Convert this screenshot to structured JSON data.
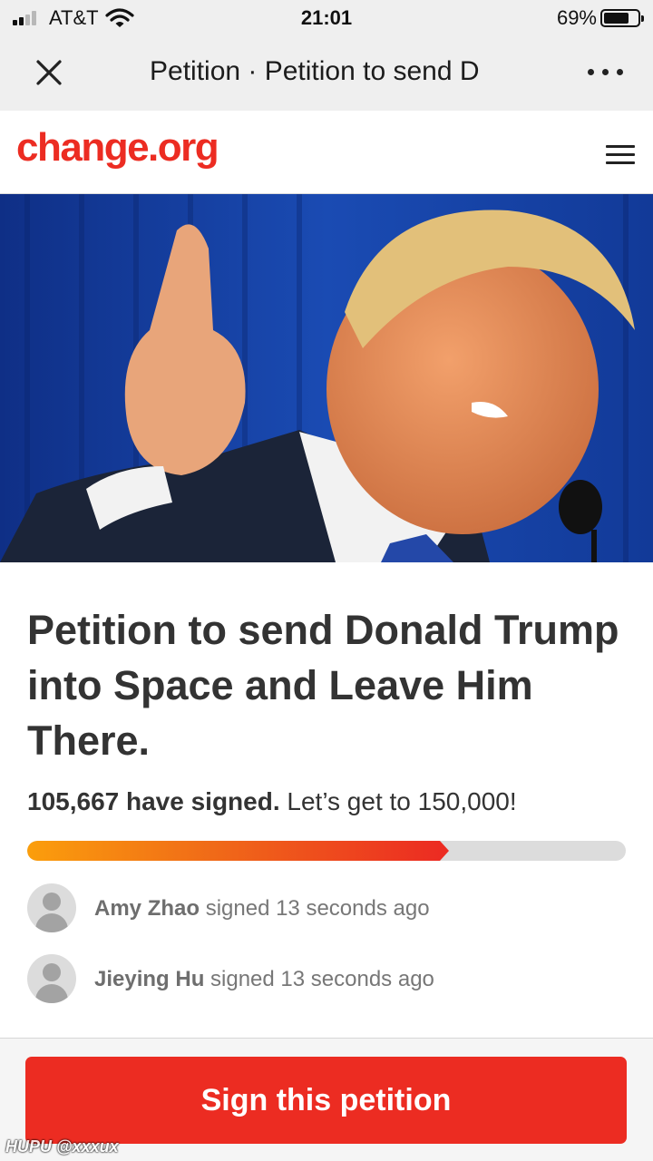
{
  "status_bar": {
    "carrier": "AT&T",
    "time": "21:01",
    "battery": "69%",
    "battery_level": 0.69,
    "signal_bars": 2
  },
  "nav_bar": {
    "title": "Petition · Petition to send D",
    "close_icon": "close-icon",
    "more_icon": "more-icon"
  },
  "site": {
    "logo": "change.org",
    "menu_icon": "hamburger-menu-icon",
    "brand_color": "#ec2c22"
  },
  "petition": {
    "title": "Petition to send Donald Trump into Space and Leave Him There.",
    "signed_count": "105,667 have signed.",
    "goal_text": "Let’s get to 150,000!",
    "progress_fraction": 0.7044
  },
  "recent_signers": [
    {
      "name": "Amy Zhao",
      "text": "signed 13 seconds ago"
    },
    {
      "name": "Jieying Hu",
      "text": "signed 13 seconds ago"
    }
  ],
  "cta": {
    "sign_label": "Sign this petition"
  },
  "watermark": "HUPU @xxxux"
}
